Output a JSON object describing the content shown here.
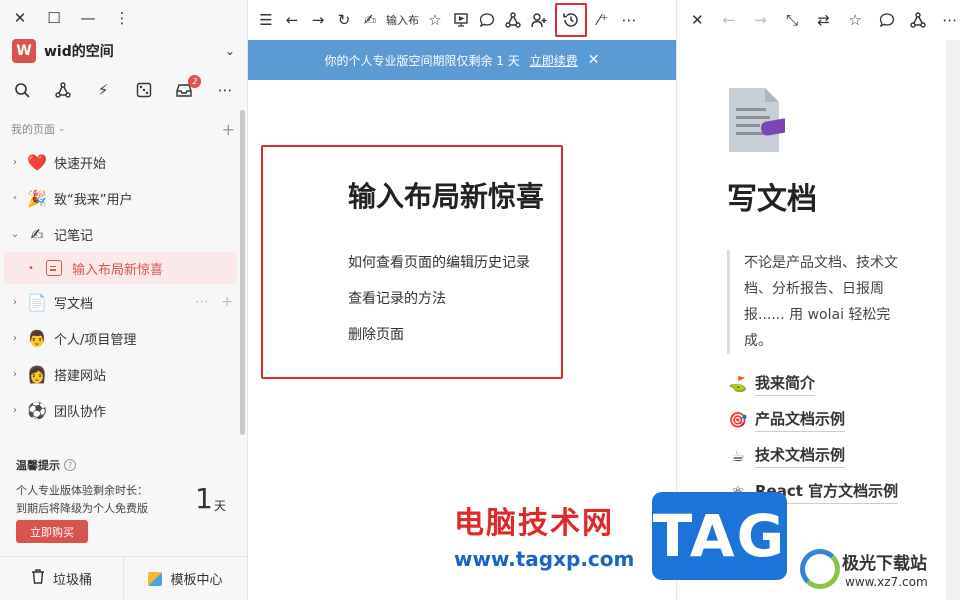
{
  "sidebar": {
    "space_logo": "W",
    "space_name": "wid的空间",
    "notify_badge": "2",
    "my_pages": "我的页面",
    "items": [
      {
        "icon": "❤️",
        "label": "快速开始"
      },
      {
        "icon": "🎉",
        "label": "致“我来”用户"
      },
      {
        "icon": "✍",
        "label": "记笔记"
      },
      {
        "label": "输入布局新惊喜"
      },
      {
        "icon": "📄",
        "label": "写文档"
      },
      {
        "icon": "👨",
        "label": "个人/项目管理"
      },
      {
        "icon": "👩",
        "label": "搭建网站"
      },
      {
        "icon": "⚽",
        "label": "团队协作"
      }
    ],
    "tip_title": "温馨提示",
    "tip_line1": "个人专业版体验剩余时长：",
    "tip_line2": "到期后将降级为个人免费版",
    "tip_days": "1",
    "tip_unit": "天",
    "buy_label": "立即购买",
    "trash_label": "垃圾桶",
    "template_label": "模板中心"
  },
  "middle": {
    "breadcrumb": "输入布",
    "banner_text": "你的个人专业版空间期限仅剩余 1 天",
    "banner_link": "立即续费",
    "doc_title": "输入布局新惊喜",
    "lines": [
      "如何查看页面的编辑历史记录",
      "查看记录的方法",
      "删除页面"
    ]
  },
  "right": {
    "title": "写文档",
    "quote": "不论是产品文档、技术文档、分析报告、日报周报...... 用 wolai 轻松完成。",
    "links": [
      {
        "icon": "⛳",
        "label": "我来简介"
      },
      {
        "icon": "🎯",
        "label": "产品文档示例"
      },
      {
        "icon": "☕",
        "label": "技术文档示例"
      },
      {
        "icon": "⚛",
        "label": "React 官方文档示例"
      }
    ]
  },
  "watermark": {
    "cn": "电脑技术网",
    "url": "www.tagxp.com",
    "tag": "TAG",
    "jg_cn": "极光下载站",
    "jg_url": "www.xz7.com"
  },
  "colors": {
    "accent": "#d9534f",
    "banner": "#5b9bd5",
    "highlight_box": "#e02a2a"
  }
}
